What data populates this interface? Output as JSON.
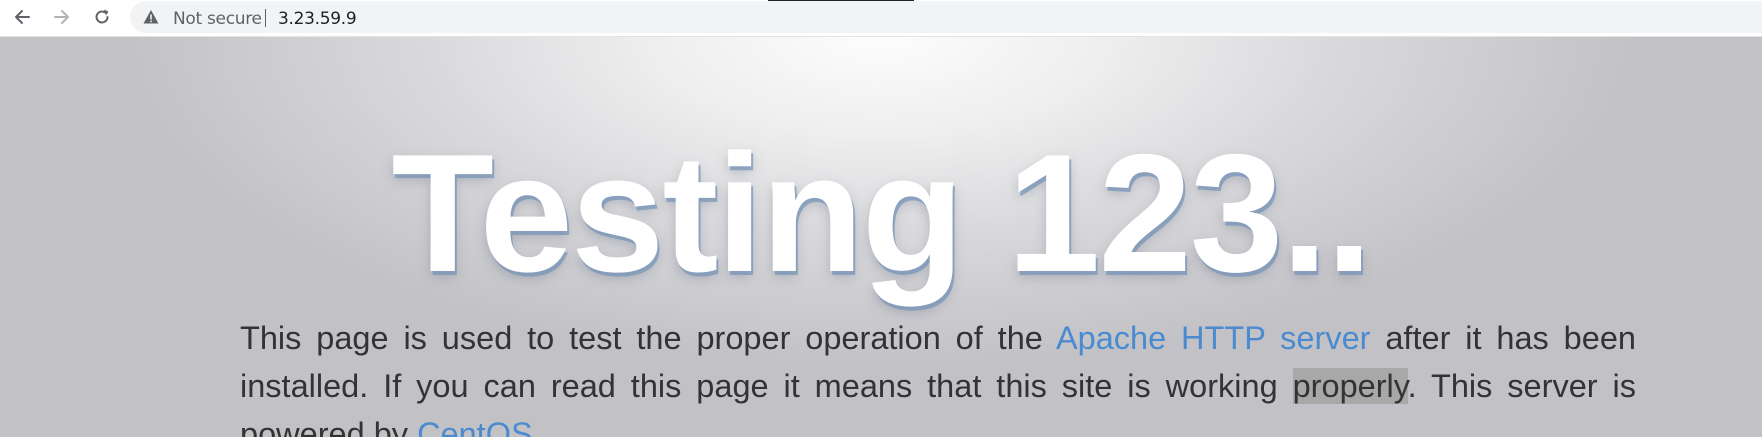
{
  "browser": {
    "security_label": "Not secure",
    "url": "3.23.59.9"
  },
  "page": {
    "headline": "Testing 123..",
    "lead": {
      "part1": "This page is used to test the proper operation of the ",
      "link_apache": "Apache HTTP server",
      "part2": " after it has been installed. If you can read this page it means that this site is working ",
      "highlighted_word": "properly",
      "part3": ". This server is powered by ",
      "link_centos": "CentOS",
      "part4": "."
    }
  },
  "colors": {
    "link": "#4a8bd0",
    "text": "#333333",
    "headline": "#ffffff",
    "selection": "#a8a8a8"
  }
}
